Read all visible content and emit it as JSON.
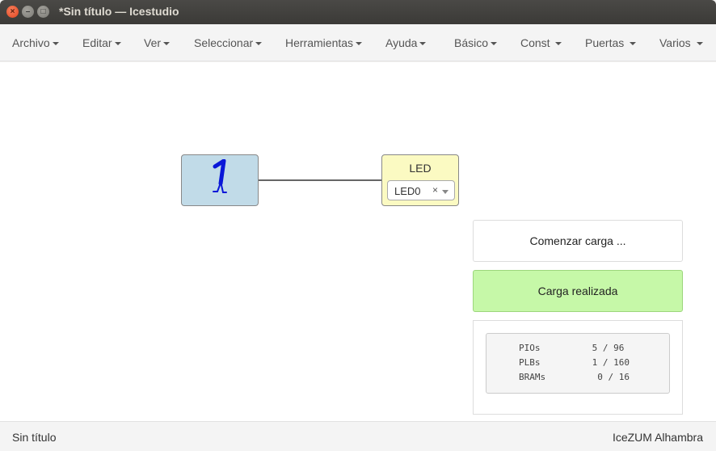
{
  "window": {
    "title": "*Sin título — Icestudio",
    "close_glyph": "×",
    "min_glyph": "–",
    "max_glyph": "□"
  },
  "menu": {
    "items": [
      {
        "label": "Archivo"
      },
      {
        "label": "Editar"
      },
      {
        "label": "Ver"
      },
      {
        "label": "Seleccionar"
      },
      {
        "label": "Herramientas"
      },
      {
        "label": "Ayuda"
      },
      {
        "label": "Básico"
      },
      {
        "label": "Const"
      },
      {
        "label": "Puertas"
      },
      {
        "label": "Varios"
      }
    ]
  },
  "canvas": {
    "const_block": {
      "icon": "constant-one-icon",
      "fill": "#c1dbe8"
    },
    "led_block": {
      "label": "LED",
      "selected_pin": "LED0",
      "clear_glyph": "×",
      "fill": "#fbfac2"
    }
  },
  "notifications": {
    "start": "Comenzar carga ...",
    "done": "Carga realizada",
    "done_color": "#c6f8a8"
  },
  "resources": {
    "rows": [
      {
        "name": "PIOs",
        "value": " 5 / 96"
      },
      {
        "name": "PLBs",
        "value": " 1 / 160"
      },
      {
        "name": "BRAMs",
        "value": "  0 / 16"
      }
    ]
  },
  "status": {
    "file": "Sin título",
    "board": "IceZUM Alhambra"
  }
}
